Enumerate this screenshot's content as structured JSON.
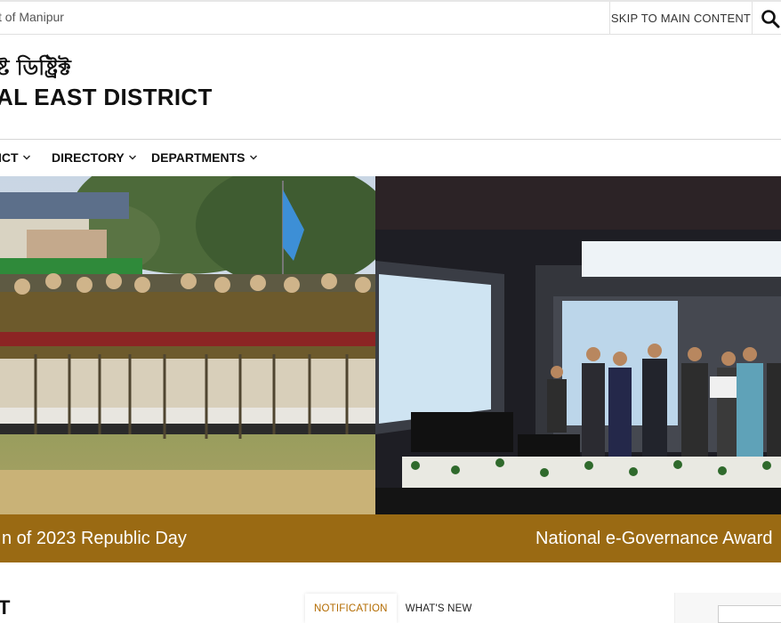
{
  "topbar": {
    "government_text": "t of Manipur",
    "skip_label": "SKIP TO MAIN CONTENT",
    "search_icon": "search-icon"
  },
  "header": {
    "title_bengali": "ষ্ট ডিষ্ট্রিক্ট",
    "title_english": "AL EAST DISTRICT"
  },
  "nav": {
    "items": [
      {
        "label": "ICT"
      },
      {
        "label": "DIRECTORY"
      },
      {
        "label": "DEPARTMENTS"
      }
    ],
    "chevron_icon": "chevron-down-icon"
  },
  "slider": {
    "slides": [
      {
        "caption": "n of 2023 Republic Day"
      },
      {
        "caption": "National e-Governance Award"
      }
    ]
  },
  "bottom": {
    "section_title": "T",
    "tabs": [
      {
        "label": "NOTIFICATION",
        "active": true
      },
      {
        "label": "WHAT'S NEW",
        "active": false
      }
    ]
  },
  "colors": {
    "caption_bar": "#9a6a13",
    "active_tab": "#b36b00"
  }
}
